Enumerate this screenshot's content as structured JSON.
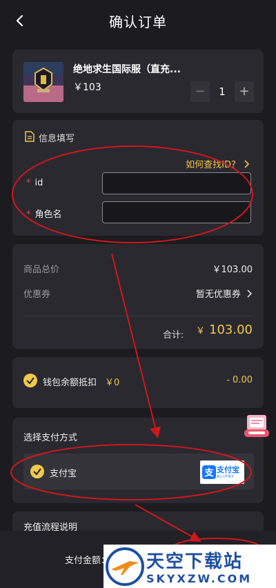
{
  "header": {
    "title": "确认订单"
  },
  "product": {
    "name": "绝地求生国际服（直充...",
    "price": "￥103",
    "quantity": "1",
    "minus": "−",
    "plus": "+"
  },
  "info": {
    "title": "信息填写",
    "find_id_link": "如何查找ID?",
    "required_mark": "*",
    "id_label": "id",
    "id_value": "",
    "role_label": "角色名",
    "role_value": ""
  },
  "summary": {
    "total_label": "商品总价",
    "total_value": "￥103.00",
    "coupon_label": "优惠券",
    "coupon_value": "暂无优惠券",
    "sum_label": "合计:",
    "sum_symbol": "￥",
    "sum_value": "103.00"
  },
  "wallet": {
    "label": "钱包余额抵扣",
    "balance": "￥0",
    "deduct": "- 0.00"
  },
  "payment": {
    "title": "选择支付方式",
    "method": "支付宝",
    "logo_text": "支付宝",
    "logo_sub": "ALIPAY"
  },
  "flow": {
    "title": "充值流程说明"
  },
  "bottom": {
    "pay_amount_label": "支付金额："
  },
  "watermark": {
    "line1": "天空下载站",
    "line2": "SKYXZW.COM"
  },
  "colors": {
    "accent": "#f2c94c",
    "required": "#e04c4c",
    "annotation": "#d0181b",
    "alipay": "#1677ff"
  }
}
